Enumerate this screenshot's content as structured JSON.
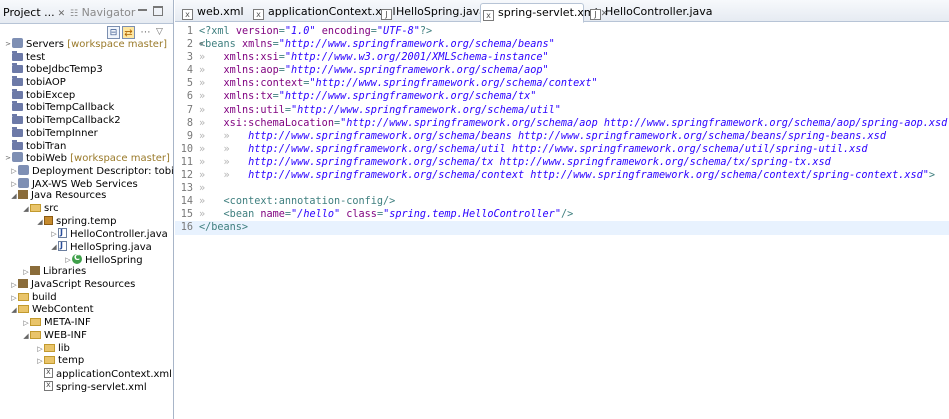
{
  "left_panel": {
    "tab_project": "Project ...",
    "tab_project_close": "✕",
    "tab_navigator": "Navigator",
    "tree": [
      {
        "label": "Servers",
        "suffix": "[workspace master]",
        "depth": 0,
        "twisty": ">",
        "icon": "servers-icon"
      },
      {
        "label": "test",
        "depth": 0,
        "twisty": "",
        "icon": "project-icon"
      },
      {
        "label": "tobeJdbcTemp3",
        "depth": 0,
        "twisty": "",
        "icon": "project-icon"
      },
      {
        "label": "tobiAOP",
        "depth": 0,
        "twisty": "",
        "icon": "project-icon"
      },
      {
        "label": "tobiExcep",
        "depth": 0,
        "twisty": "",
        "icon": "project-icon"
      },
      {
        "label": "tobiTempCallback",
        "depth": 0,
        "twisty": "",
        "icon": "project-icon"
      },
      {
        "label": "tobiTempCallback2",
        "depth": 0,
        "twisty": "",
        "icon": "project-icon"
      },
      {
        "label": "tobiTempInner",
        "depth": 0,
        "twisty": "",
        "icon": "project-icon"
      },
      {
        "label": "tobiTran",
        "depth": 0,
        "twisty": "",
        "icon": "project-icon"
      },
      {
        "label": "tobiWeb",
        "suffix": "[workspace master]",
        "depth": 0,
        "twisty": ">",
        "icon": "web-project-icon"
      },
      {
        "label": "Deployment Descriptor: tobiWeb",
        "depth": 1,
        "twisty": "▷",
        "icon": "deployment-descriptor-icon"
      },
      {
        "label": "JAX-WS Web Services",
        "depth": 1,
        "twisty": "▷",
        "icon": "web-services-icon"
      },
      {
        "label": "Java Resources",
        "depth": 1,
        "twisty": "◢",
        "icon": "java-resources-icon"
      },
      {
        "label": "src",
        "depth": 2,
        "twisty": "◢",
        "icon": "source-folder-icon"
      },
      {
        "label": "spring.temp",
        "depth": 3,
        "twisty": "◢",
        "icon": "package-icon"
      },
      {
        "label": "HelloController.java",
        "depth": 4,
        "twisty": "▷",
        "icon": "java-file-icon"
      },
      {
        "label": "HelloSpring.java",
        "depth": 4,
        "twisty": "◢",
        "icon": "java-file-icon"
      },
      {
        "label": "HelloSpring",
        "depth": 5,
        "twisty": "▷",
        "icon": "class-icon"
      },
      {
        "label": "Libraries",
        "depth": 2,
        "twisty": "▷",
        "icon": "libraries-icon"
      },
      {
        "label": "JavaScript Resources",
        "depth": 1,
        "twisty": "▷",
        "icon": "javascript-resources-icon"
      },
      {
        "label": "build",
        "depth": 1,
        "twisty": "▷",
        "icon": "folder-icon"
      },
      {
        "label": "WebContent",
        "depth": 1,
        "twisty": "◢",
        "icon": "folder-icon"
      },
      {
        "label": "META-INF",
        "depth": 2,
        "twisty": "▷",
        "icon": "folder-icon"
      },
      {
        "label": "WEB-INF",
        "depth": 2,
        "twisty": "◢",
        "icon": "folder-icon"
      },
      {
        "label": "lib",
        "depth": 3,
        "twisty": "▷",
        "icon": "folder-icon"
      },
      {
        "label": "temp",
        "depth": 3,
        "twisty": "▷",
        "icon": "folder-icon"
      },
      {
        "label": "applicationContext.xml",
        "depth": 3,
        "twisty": "",
        "icon": "xml-file-icon"
      },
      {
        "label": "spring-servlet.xml",
        "depth": 3,
        "twisty": "",
        "icon": "xml-file-icon"
      }
    ]
  },
  "editor": {
    "tabs": [
      {
        "label": "web.xml",
        "icon": "xml-file-icon",
        "active": false
      },
      {
        "label": "applicationContext.xml",
        "icon": "xml-file-icon",
        "active": false
      },
      {
        "label": "HelloSpring.java",
        "icon": "java-file-icon",
        "active": false
      },
      {
        "label": "spring-servlet.xml",
        "icon": "xml-file-icon",
        "active": true,
        "close": "✕"
      },
      {
        "label": "HelloController.java",
        "icon": "java-file-icon",
        "active": false
      }
    ],
    "lines": [
      {
        "n": "1",
        "tokens": [
          [
            "pi",
            "<?xml "
          ],
          [
            "attr",
            "version"
          ],
          [
            "pi",
            "="
          ],
          [
            "val",
            "\"1.0\""
          ],
          [
            "pi",
            " "
          ],
          [
            "attr",
            "encoding"
          ],
          [
            "pi",
            "="
          ],
          [
            "val",
            "\"UTF-8\""
          ],
          [
            "pi",
            "?>"
          ]
        ]
      },
      {
        "n": "2",
        "fold": "⊖",
        "tokens": [
          [
            "tag",
            "<beans "
          ],
          [
            "attr",
            "xmlns"
          ],
          [
            "tag",
            "="
          ],
          [
            "val",
            "\"http://www.springframework.org/schema/beans\""
          ]
        ]
      },
      {
        "n": "3",
        "tokens": [
          [
            "ws",
            "»   "
          ],
          [
            "attr",
            "xmlns:xsi"
          ],
          [
            "tag",
            "="
          ],
          [
            "val",
            "\"http://www.w3.org/2001/XMLSchema-instance\""
          ]
        ]
      },
      {
        "n": "4",
        "tokens": [
          [
            "ws",
            "»   "
          ],
          [
            "attr",
            "xmlns:aop"
          ],
          [
            "tag",
            "="
          ],
          [
            "val",
            "\"http://www.springframework.org/schema/aop\""
          ]
        ]
      },
      {
        "n": "5",
        "tokens": [
          [
            "ws",
            "»   "
          ],
          [
            "attr",
            "xmlns:context"
          ],
          [
            "tag",
            "="
          ],
          [
            "val",
            "\"http://www.springframework.org/schema/context\""
          ]
        ]
      },
      {
        "n": "6",
        "tokens": [
          [
            "ws",
            "»   "
          ],
          [
            "attr",
            "xmlns:tx"
          ],
          [
            "tag",
            "="
          ],
          [
            "val",
            "\"http://www.springframework.org/schema/tx\""
          ]
        ]
      },
      {
        "n": "7",
        "tokens": [
          [
            "ws",
            "»   "
          ],
          [
            "attr",
            "xmlns:util"
          ],
          [
            "tag",
            "="
          ],
          [
            "val",
            "\"http://www.springframework.org/schema/util\""
          ]
        ]
      },
      {
        "n": "8",
        "tokens": [
          [
            "ws",
            "»   "
          ],
          [
            "attr",
            "xsi:schemaLocation"
          ],
          [
            "tag",
            "="
          ],
          [
            "val",
            "\"http://www.springframework.org/schema/aop http://www.springframework.org/schema/aop/spring-aop.xsd"
          ]
        ]
      },
      {
        "n": "9",
        "tokens": [
          [
            "ws",
            "»   »   "
          ],
          [
            "val",
            "http://www.springframework.org/schema/beans http://www.springframework.org/schema/beans/spring-beans.xsd"
          ]
        ]
      },
      {
        "n": "10",
        "tokens": [
          [
            "ws",
            "»   »   "
          ],
          [
            "val",
            "http://www.springframework.org/schema/util http://www.springframework.org/schema/util/spring-util.xsd"
          ]
        ]
      },
      {
        "n": "11",
        "tokens": [
          [
            "ws",
            "»   »   "
          ],
          [
            "val",
            "http://www.springframework.org/schema/tx http://www.springframework.org/schema/tx/spring-tx.xsd"
          ]
        ]
      },
      {
        "n": "12",
        "tokens": [
          [
            "ws",
            "»   »   "
          ],
          [
            "val",
            "http://www.springframework.org/schema/context http://www.springframework.org/schema/context/spring-context.xsd\""
          ],
          [
            "tag",
            ">"
          ]
        ]
      },
      {
        "n": "13",
        "tokens": [
          [
            "ws",
            "»   "
          ]
        ]
      },
      {
        "n": "14",
        "tokens": [
          [
            "ws",
            "»   "
          ],
          [
            "tag",
            "<context:annotation-config/>"
          ]
        ]
      },
      {
        "n": "15",
        "tokens": [
          [
            "ws",
            "»   "
          ],
          [
            "tag",
            "<bean "
          ],
          [
            "attr",
            "name"
          ],
          [
            "tag",
            "="
          ],
          [
            "val",
            "\"/hello\""
          ],
          [
            "tag",
            " "
          ],
          [
            "attr",
            "class"
          ],
          [
            "tag",
            "="
          ],
          [
            "val",
            "\"spring.temp.HelloController\""
          ],
          [
            "tag",
            "/>"
          ]
        ]
      },
      {
        "n": "16",
        "current": true,
        "tokens": [
          [
            "tag",
            "</beans>"
          ]
        ]
      }
    ]
  }
}
